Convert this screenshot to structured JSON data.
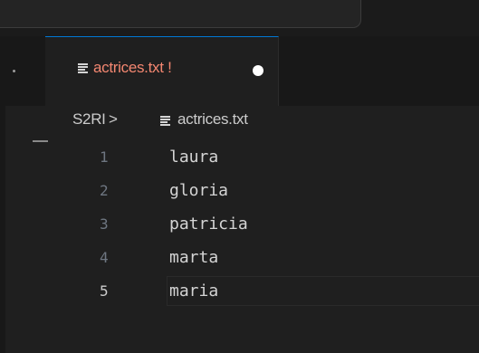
{
  "tab": {
    "icon": "text-file-icon",
    "label": "actrices.txt !",
    "dirty_icon": "unsaved-dot-icon",
    "label_color": "#f48771"
  },
  "breadcrumb": {
    "folder": "S2RI",
    "separator": ">",
    "file_icon": "text-file-icon",
    "file": "actrices.txt"
  },
  "editor": {
    "current_line": 5,
    "lines": [
      {
        "number": "1",
        "text": "laura"
      },
      {
        "number": "2",
        "text": "gloria"
      },
      {
        "number": "3",
        "text": "patricia"
      },
      {
        "number": "4",
        "text": "marta"
      },
      {
        "number": "5",
        "text": "maria"
      }
    ]
  },
  "colors": {
    "background": "#1f1f1f",
    "accent": "#0078d4",
    "modified": "#f48771"
  }
}
